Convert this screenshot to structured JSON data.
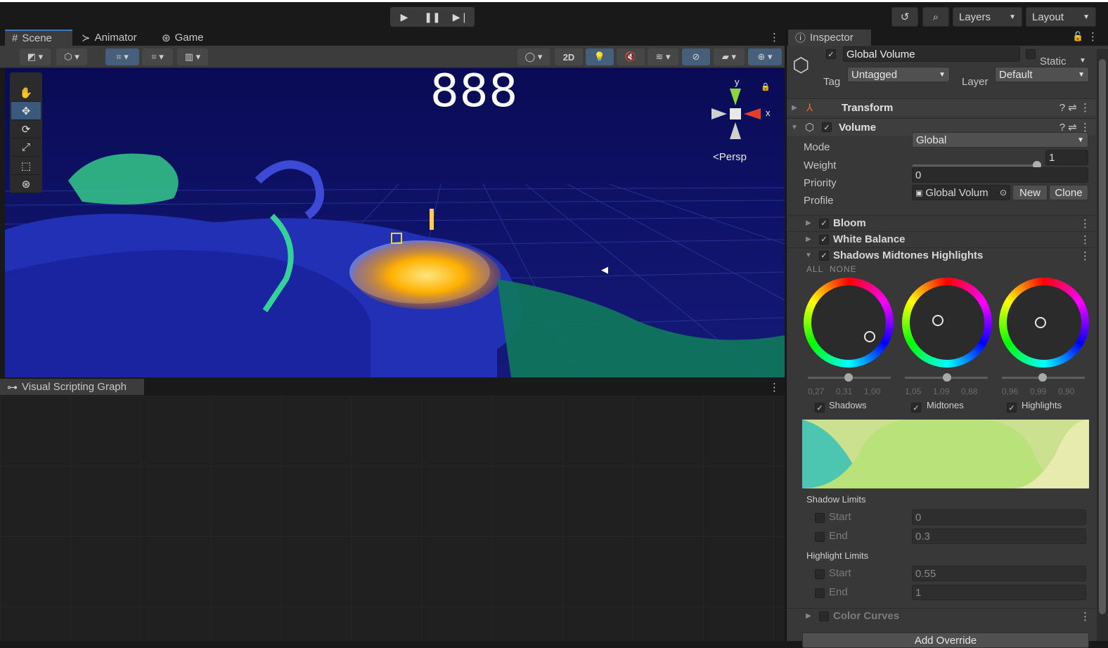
{
  "toolbar": {
    "play_icon": "play-icon",
    "pause_icon": "pause-icon",
    "step_icon": "step-icon",
    "layers_label": "Layers",
    "layout_label": "Layout"
  },
  "scene_panel": {
    "tabs": [
      {
        "label": "Scene",
        "icon": "scene-grid-icon"
      },
      {
        "label": "Animator",
        "icon": "animator-icon"
      },
      {
        "label": "Game",
        "icon": "gamepad-icon"
      }
    ],
    "toggle_2d": "2D",
    "fps_counter": "888",
    "projection_label": "<Persp",
    "gizmo_axes": {
      "y": "y",
      "x": "x"
    }
  },
  "visual_scripting": {
    "tab_label": "Visual Scripting Graph"
  },
  "inspector": {
    "tab_label": "Inspector",
    "object_name": "Global Volume",
    "static_label": "Static",
    "tag_label": "Tag",
    "tag_value": "Untagged",
    "layer_label": "Layer",
    "layer_value": "Default",
    "components": {
      "transform": "Transform",
      "volume": "Volume"
    },
    "volume": {
      "mode_label": "Mode",
      "mode_value": "Global",
      "weight_label": "Weight",
      "weight_value": "1",
      "weight_fraction": 1.0,
      "priority_label": "Priority",
      "priority_value": "0",
      "profile_label": "Profile",
      "profile_value": "Global Volum",
      "new_label": "New",
      "clone_label": "Clone"
    },
    "overrides": {
      "bloom": "Bloom",
      "white_balance": "White Balance",
      "smh": "Shadows Midtones Highlights",
      "color_curves": "Color Curves"
    },
    "all_label": "ALL",
    "none_label": "NONE",
    "wheels": [
      {
        "label": "Shadows",
        "values": "0,27     0,31     1,00"
      },
      {
        "label": "Midtones",
        "values": "1,05     1,09     0,88"
      },
      {
        "label": "Highlights",
        "values": "0,96     0,99     0,90"
      }
    ],
    "shadow_limits": {
      "header": "Shadow Limits",
      "start_label": "Start",
      "start_value": "0",
      "end_label": "End",
      "end_value": "0.3"
    },
    "highlight_limits": {
      "header": "Highlight Limits",
      "start_label": "Start",
      "start_value": "0.55",
      "end_label": "End",
      "end_value": "1"
    },
    "add_override_label": "Add Override"
  }
}
